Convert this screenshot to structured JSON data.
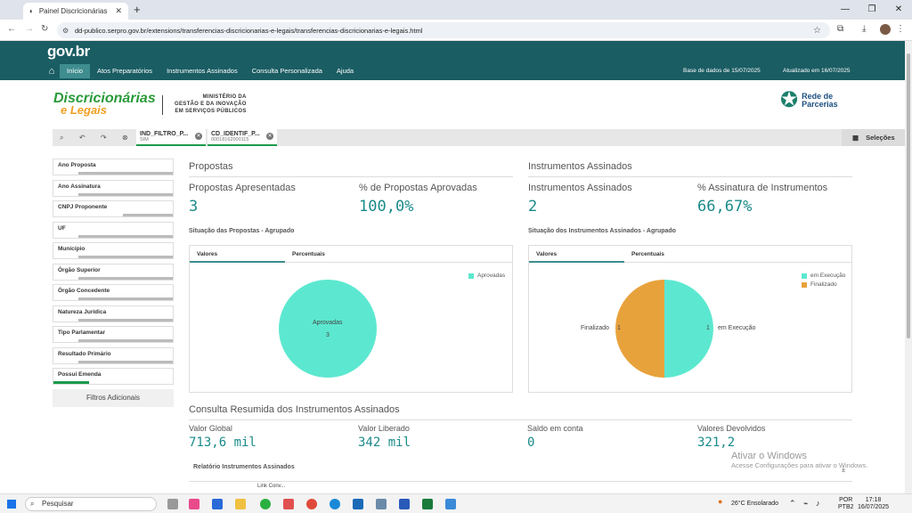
{
  "browser": {
    "tab_title": "Painel Discricionárias",
    "url": "dd-publico.serpro.gov.br/extensions/transferencias-discricionarias-e-legais/transferencias-discricionarias-e-legais.html"
  },
  "header": {
    "brand": "gov.br",
    "nav": [
      "Início",
      "Atos Preparatórios",
      "Instrumentos Assinados",
      "Consulta Personalizada",
      "Ajuda"
    ],
    "base_dados": "Base de dados de 15/07/2025",
    "atualizado": "Atualizado em 16/07/2025"
  },
  "logos": {
    "disc_line1": "Discricionárias",
    "disc_line2": "e Legais",
    "ministerio_1": "MINISTÉRIO DA",
    "ministerio_2": "GESTÃO E DA INOVAÇÃO",
    "ministerio_3": "EM SERVIÇOS PÚBLICOS",
    "rede_1": "Rede de",
    "rede_2": "Parcerias"
  },
  "selections": {
    "chips": [
      {
        "name": "IND_FILTRO_P...",
        "value": "SIM"
      },
      {
        "name": "CD_IDENTIF_P...",
        "value": "00018162000115"
      }
    ],
    "button": "Seleções"
  },
  "filters": {
    "items": [
      "Ano Proposta",
      "Ano Assinatura",
      "CNPJ Proponente",
      "UF",
      "Município",
      "Órgão Superior",
      "Órgão Concedente",
      "Natureza Jurídica",
      "Tipo Parlamentar",
      "Resultado Primário",
      "Possui Emenda"
    ],
    "additional": "Filtros Adicionais"
  },
  "propostas": {
    "title": "Propostas",
    "apresentadas_label": "Propostas Apresentadas",
    "apresentadas_value": "3",
    "aprovadas_label": "% de Propostas Aprovadas",
    "aprovadas_value": "100,0%",
    "chart_title": "Situação das Propostas - Agrupado",
    "tabs": [
      "Valores",
      "Percentuais"
    ],
    "legend": [
      "Aprovadas"
    ],
    "slice_label": "Aprovadas",
    "slice_value": "3"
  },
  "instrumentos": {
    "title": "Instrumentos Assinados",
    "assinados_label": "Instrumentos Assinados",
    "assinados_value": "2",
    "perc_label": "% Assinatura de Instrumentos",
    "perc_value": "66,67%",
    "chart_title": "Situação dos Instrumentos Assinados - Agrupado",
    "tabs": [
      "Valores",
      "Percentuais"
    ],
    "legend": [
      "em Execução",
      "Finalizado"
    ],
    "label_left": "Finalizado",
    "value_left": "1",
    "label_right": "em Execução",
    "value_right": "1"
  },
  "chart_data": [
    {
      "type": "pie",
      "title": "Situação das Propostas - Agrupado",
      "categories": [
        "Aprovadas"
      ],
      "values": [
        3
      ],
      "colors": [
        "#5ce8d0"
      ],
      "legend": "top-right"
    },
    {
      "type": "pie",
      "title": "Situação dos Instrumentos Assinados - Agrupado",
      "categories": [
        "em Execução",
        "Finalizado"
      ],
      "values": [
        1,
        1
      ],
      "colors": [
        "#5ce8d0",
        "#e8a23c"
      ],
      "legend": "top-right"
    }
  ],
  "consulta": {
    "title": "Consulta Resumida dos Instrumentos Assinados",
    "kpis": [
      {
        "label": "Valor Global",
        "value": "713,6 mil"
      },
      {
        "label": "Valor Liberado",
        "value": "342 mil"
      },
      {
        "label": "Saldo em conta",
        "value": "0"
      },
      {
        "label": "Valores Devolvidos",
        "value": "321,2"
      }
    ],
    "report_title": "Relatório Instrumentos Assinados",
    "table_cols": [
      "Link Conv..."
    ]
  },
  "watermark": {
    "line1": "Ativar o Windows",
    "line2": "Acesse Configurações para ativar o Windows."
  },
  "taskbar": {
    "search": "Pesquisar",
    "weather": "26°C  Ensolarado",
    "lang1": "POR",
    "lang2": "PTB2",
    "time": "17:18",
    "date": "16/07/2025"
  },
  "colors": {
    "header": "#1a5d63",
    "accent": "#1a8a8a",
    "teal_slice": "#5ce8d0",
    "orange_slice": "#e8a23c"
  }
}
